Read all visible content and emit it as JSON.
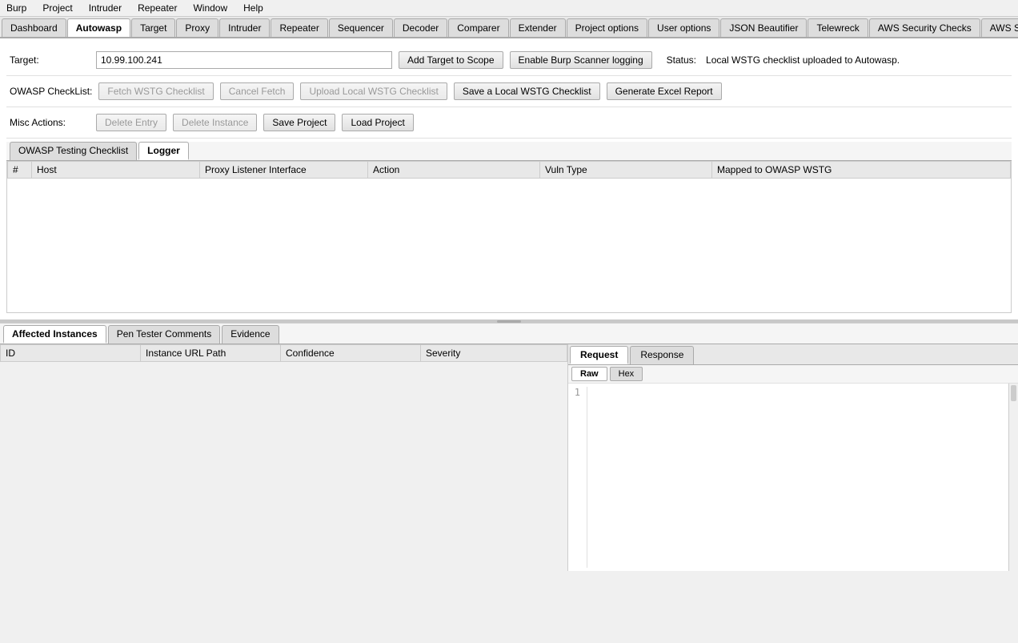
{
  "menuBar": {
    "items": [
      "Burp",
      "Project",
      "Intruder",
      "Repeater",
      "Window",
      "Help"
    ]
  },
  "tabBar": {
    "tabs": [
      {
        "label": "Dashboard",
        "active": false
      },
      {
        "label": "Autowasp",
        "active": true
      },
      {
        "label": "Target",
        "active": false
      },
      {
        "label": "Proxy",
        "active": false
      },
      {
        "label": "Intruder",
        "active": false
      },
      {
        "label": "Repeater",
        "active": false
      },
      {
        "label": "Sequencer",
        "active": false
      },
      {
        "label": "Decoder",
        "active": false
      },
      {
        "label": "Comparer",
        "active": false
      },
      {
        "label": "Extender",
        "active": false
      },
      {
        "label": "Project options",
        "active": false
      },
      {
        "label": "User options",
        "active": false
      },
      {
        "label": "JSON Beautifier",
        "active": false
      },
      {
        "label": "Telewreck",
        "active": false
      },
      {
        "label": "AWS Security Checks",
        "active": false
      },
      {
        "label": "AWS Signer",
        "active": false
      }
    ]
  },
  "targetRow": {
    "label": "Target:",
    "inputValue": "10.99.100.241",
    "addTargetBtn": "Add Target to Scope",
    "enableLoggingBtn": "Enable Burp Scanner logging",
    "statusLabel": "Status:",
    "statusText": "Local WSTG checklist uploaded to Autowasp."
  },
  "owaspRow": {
    "label": "OWASP CheckList:",
    "fetchBtn": "Fetch WSTG Checklist",
    "cancelFetchBtn": "Cancel Fetch",
    "uploadBtn": "Upload Local WSTG Checklist",
    "saveBtn": "Save a Local WSTG Checklist",
    "generateBtn": "Generate Excel Report"
  },
  "miscRow": {
    "label": "Misc Actions:",
    "deleteEntryBtn": "Delete Entry",
    "deleteInstanceBtn": "Delete Instance",
    "saveProjectBtn": "Save Project",
    "loadProjectBtn": "Load Project"
  },
  "innerTabs": {
    "tabs": [
      {
        "label": "OWASP Testing Checklist",
        "active": false
      },
      {
        "label": "Logger",
        "active": true
      }
    ]
  },
  "loggerTable": {
    "headers": [
      "#",
      "Host",
      "Proxy Listener Interface",
      "Action",
      "Vuln Type",
      "Mapped to OWASP WSTG"
    ],
    "rows": []
  },
  "bottomTabs": {
    "tabs": [
      {
        "label": "Affected Instances",
        "active": true
      },
      {
        "label": "Pen Tester Comments",
        "active": false
      },
      {
        "label": "Evidence",
        "active": false
      }
    ]
  },
  "instancesTable": {
    "headers": [
      "ID",
      "Instance URL Path",
      "Confidence",
      "Severity"
    ],
    "rows": []
  },
  "requestPane": {
    "tabs": [
      {
        "label": "Request",
        "active": true
      },
      {
        "label": "Response",
        "active": false
      }
    ],
    "subTabs": [
      {
        "label": "Raw",
        "active": true
      },
      {
        "label": "Hex",
        "active": false
      }
    ],
    "lineNumbers": [
      "1"
    ],
    "content": ""
  }
}
